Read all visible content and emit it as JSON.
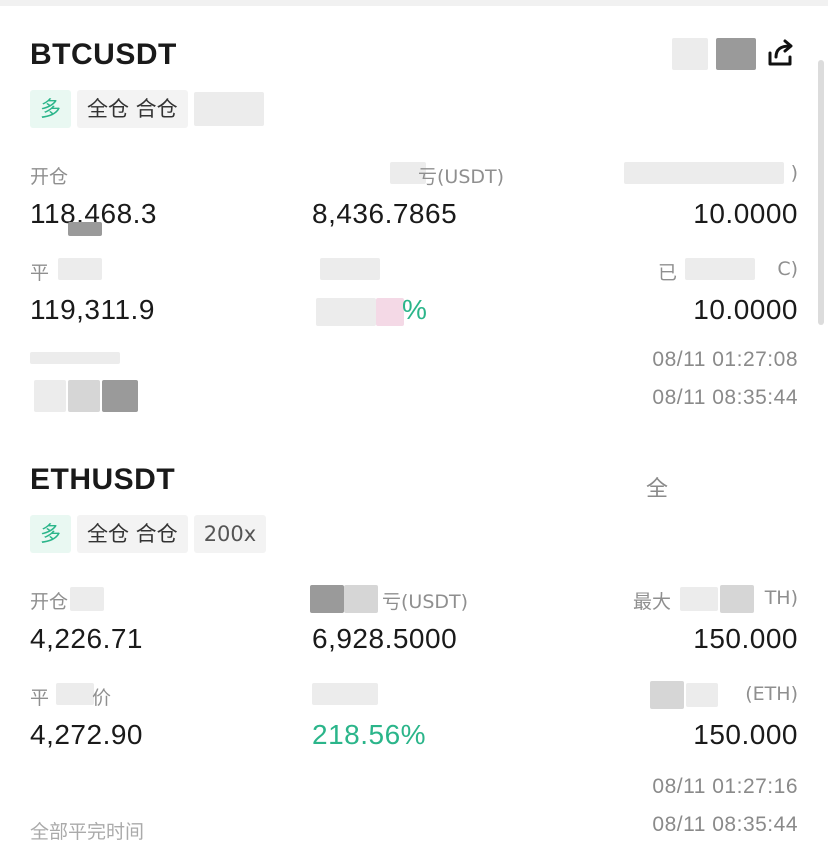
{
  "btc": {
    "symbol": "BTCUSDT",
    "tags": [
      "多",
      "全仓 合仓"
    ],
    "labels": {
      "open_price": "开仓",
      "pnl": "亏(USDT)",
      "col3_top": ")",
      "close_price": "平",
      "roi": "%",
      "col3_bottom": "已",
      "col3_bottom_unit": "C)"
    },
    "values": {
      "open_price": "118,468.3",
      "pnl": "8,436.7865",
      "col3_top": "10.0000",
      "close_price": "119,311.9",
      "col3_bottom": "10.0000"
    },
    "times": [
      "08/11 01:27:08",
      "08/11 08:35:44"
    ],
    "share_icon": "share-icon"
  },
  "eth": {
    "symbol": "ETHUSDT",
    "right_glyph": "全",
    "tags": [
      "多",
      "全仓 合仓",
      "200x"
    ],
    "labels": {
      "open_price": "开仓",
      "pnl": "亏(USDT)",
      "max": "最大",
      "max_unit": "TH)",
      "close_price": "平",
      "close_price_tail": "价",
      "col3_bottom_unit": "(ETH)",
      "full_close_time": "全部平完时间"
    },
    "values": {
      "open_price": "4,226.71",
      "pnl": "6,928.5000",
      "max": "150.000",
      "close_price": "4,272.90",
      "roi": "218.56%",
      "col3_bottom": "150.000"
    },
    "times": [
      "08/11 01:27:16",
      "08/11 08:35:44"
    ]
  },
  "colors": {
    "green": "#2bb58a",
    "text": "#1a1a1a",
    "muted": "#8f8f8f"
  }
}
